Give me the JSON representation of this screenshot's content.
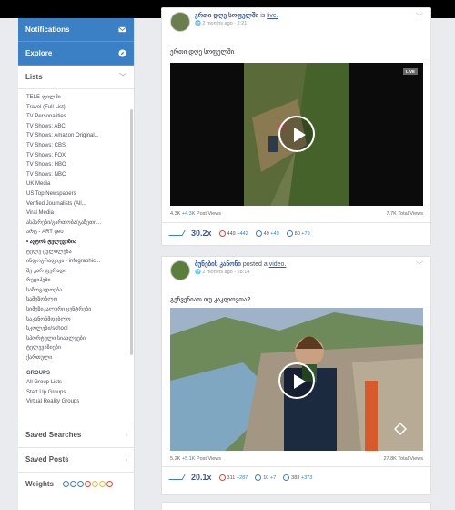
{
  "sidebar": {
    "notifications_label": "Notifications",
    "explore_label": "Explore",
    "lists_label": "Lists",
    "list_items": [
      "TELE-ფილმი",
      "Travel (Full List)",
      "TV Personalities",
      "TV Shows: ABC",
      "TV Shows: Amazon Original...",
      "TV Shows: CBS",
      "TV Shows: FOX",
      "TV Shows: HBO",
      "TV Shows: NBC",
      "UK Media",
      "US Top Newspapers",
      "Verified Journalists (All...",
      "Viral Media",
      "ასპარეზი/გართობა/გაზეთი...",
      "არტ - ART geo",
      "ავტოს ტელევიზია",
      "ტელე ცვლილება",
      "ინფოგრაფიკა - infographic...",
      "მე ვარ ფერადი",
      "რეციპები",
      "საზოგადოება",
      "სამეზობლო",
      "სიმუზიკალური ცენტრები",
      "საკანონმდებლო",
      "სკოლები/school",
      "სპორტული სიახლეები",
      "ტელევიზიები",
      "ქართული"
    ],
    "active_index": 15,
    "groups_heading": "GROUPS",
    "group_items": [
      "All Group Lists",
      "Start Up Groups",
      "Virtual Reality Groups"
    ],
    "saved_searches_label": "Saved Searches",
    "saved_posts_label": "Saved Posts",
    "weights_label": "Weights",
    "weights_colors": [
      "#3b7fc4",
      "#3b7fc4",
      "#3b7fc4",
      "#e7442c",
      "#f7b928",
      "#f7b928",
      "#e7442c"
    ]
  },
  "posts": [
    {
      "author": "ვრთი დღე სოფელში",
      "action_prefix": "is",
      "action_link": "live.",
      "time": "2 months ago · 2:21",
      "text": "ერთი დღე სოფელში",
      "badge": "LIVE",
      "post_views_base": "4.3K",
      "post_views_inc": "+4.3K",
      "post_views_label": "Post Views",
      "total_views": "7.7K Total Views",
      "multiplier": "30.2x",
      "reactions": "449",
      "reactions_inc": "+442",
      "comments": "49",
      "comments_inc": "+49",
      "shares": "80",
      "shares_inc": "+79"
    },
    {
      "author": "ბუნების კანონი",
      "action_prefix": "posted a",
      "action_link": "video.",
      "time": "2 months ago · 28:14",
      "text": "გეჩვენიათ თუ კაკლოვთა?",
      "post_views_base": "5.2K",
      "post_views_inc": "+5.1K",
      "post_views_label": "Post Views",
      "total_views": "27.8K Total Views",
      "multiplier": "20.1x",
      "reactions": "311",
      "reactions_inc": "+287",
      "comments": "10",
      "comments_inc": "+7",
      "shares": "383",
      "shares_inc": "+373"
    }
  ]
}
